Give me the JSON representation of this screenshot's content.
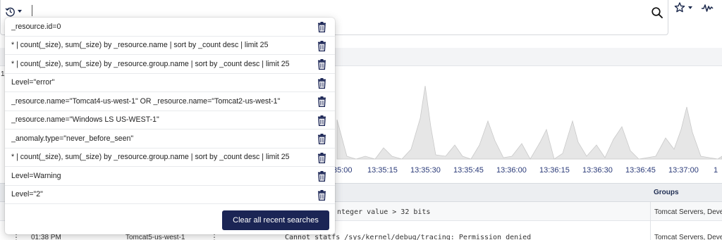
{
  "search": {
    "query_value": ""
  },
  "icons": {
    "history": "history-clock-icon",
    "caret": "chevron-down-icon",
    "search": "magnifier-icon",
    "favorite": "star-outline-icon",
    "favorite_caret": "chevron-down-icon",
    "pulse": "activity-pulse-icon",
    "delete": "trash-icon"
  },
  "colors": {
    "accent": "#1b2555",
    "tick_label": "#2a3a78",
    "chart_fill": "#e6e6e6",
    "chart_stroke": "#c9c9c9"
  },
  "recent_searches": [
    "_resource.id=0",
    "* | count(_size), sum(_size) by _resource.name | sort by _count desc | limit 25",
    "* | count(_size), sum(_size) by _resource.group.name | sort by _count desc | limit 25",
    "Level=\"error\"",
    "_resource.name=\"Tomcat4-us-west-1\" OR _resource.name=\"Tomcat2-us-west-1\"",
    "_resource.name=\"Windows LS US-WEST-1\"",
    "_anomaly.type=\"never_before_seen\"",
    "* | count(_size), sum(_size) by _resource.group.name | sort by _count desc | limit 25",
    "Level=Warning",
    "Level=\"2\""
  ],
  "clear_button_label": "Clear all recent searches",
  "chart_left_label": "1",
  "chart_data": {
    "type": "area",
    "x_tick_labels": [
      "35:00",
      "13:35:15",
      "13:35:30",
      "13:35:45",
      "13:36:00",
      "13:36:15",
      "13:36:30",
      "13:36:45",
      "13:37:00",
      "1"
    ],
    "title": "",
    "xlabel": "",
    "ylabel": ""
  },
  "table": {
    "columns": {
      "groups": "Groups"
    },
    "rows": [
      {
        "time": "",
        "resource": "",
        "message": "nteger value > 32 bits",
        "groups": "Tomcat Servers, Devel"
      },
      {
        "time": "01:38 PM",
        "resource": "Tomcat5-us-west-1",
        "message": "Cannot statfs /sys/kernel/debug/tracing: Permission denied",
        "groups": "Tomcat Servers, Devel"
      }
    ]
  }
}
